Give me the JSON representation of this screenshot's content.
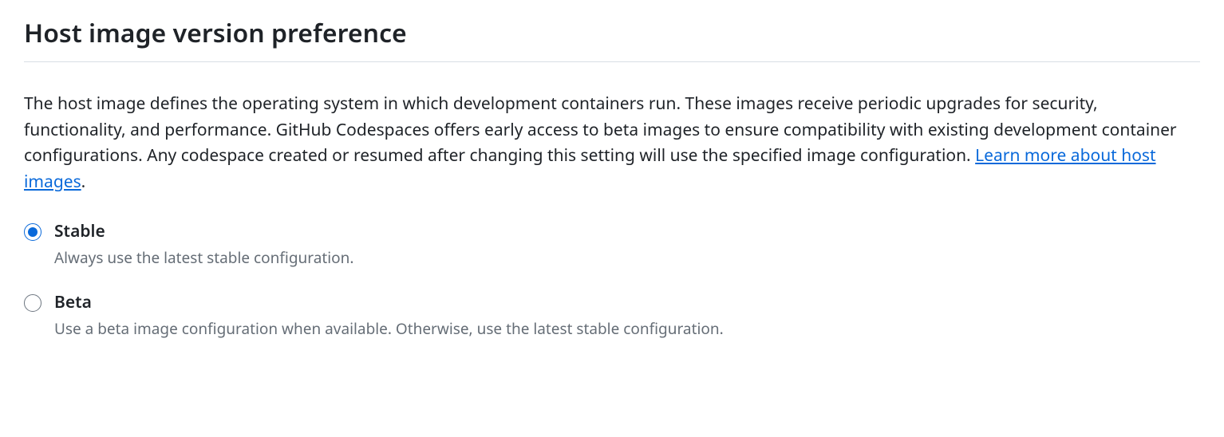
{
  "section": {
    "title": "Host image version preference",
    "description_text": "The host image defines the operating system in which development containers run. These images receive periodic upgrades for security, functionality, and performance. GitHub Codespaces offers early access to beta images to ensure compatibility with existing development container configurations. Any codespace created or resumed after changing this setting will use the specified image configuration. ",
    "link_text": "Learn more about host images",
    "period": "."
  },
  "options": {
    "stable": {
      "label": "Stable",
      "description": "Always use the latest stable configuration.",
      "checked": true
    },
    "beta": {
      "label": "Beta",
      "description": "Use a beta image configuration when available. Otherwise, use the latest stable configuration.",
      "checked": false
    }
  }
}
